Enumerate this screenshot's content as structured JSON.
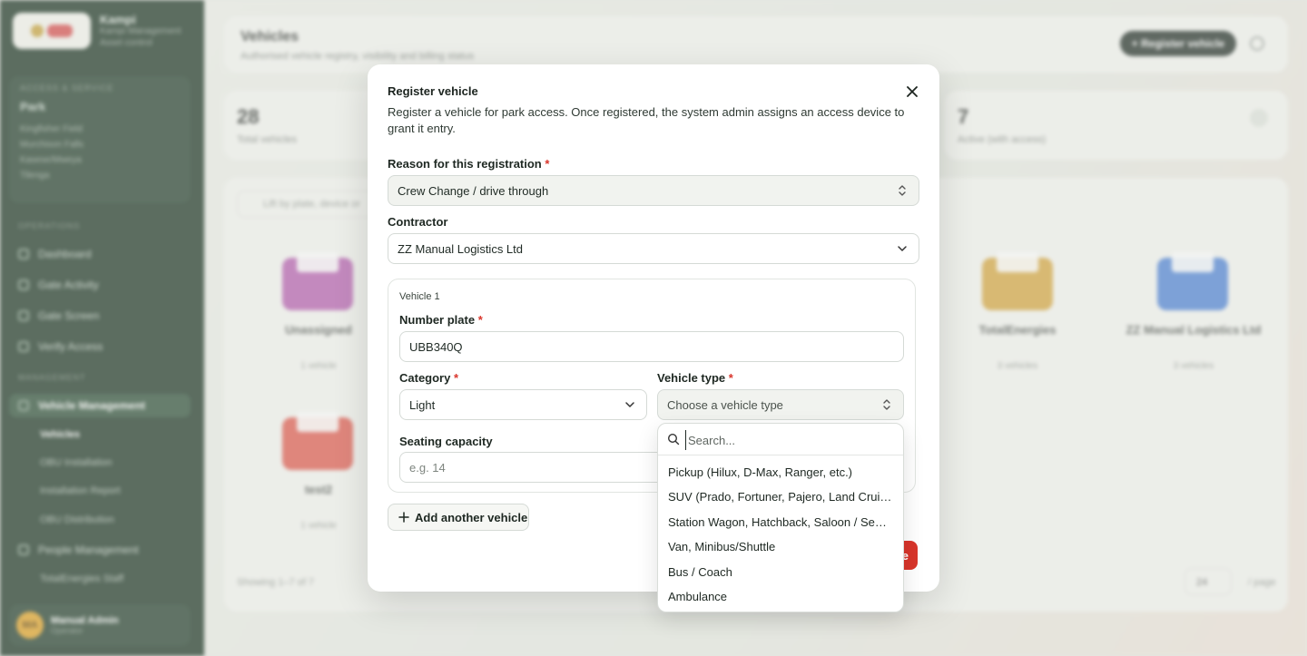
{
  "background": {
    "brand": {
      "name": "Kampi",
      "line1": "Kampi Management",
      "line2": "Asset control"
    },
    "park": {
      "heading": "ACCESS & SERVICE",
      "value": "Park",
      "lines": [
        "Kingfisher Field",
        "Murchison Falls",
        "Kasese/Mweya",
        "Tilenga"
      ]
    },
    "sections": {
      "operations": "OPERATIONS",
      "management": "MANAGEMENT"
    },
    "nav": {
      "dashboard": "Dashboard",
      "gate_activity": "Gate Activity",
      "gate_screen": "Gate Screen",
      "verify_access": "Verify Access",
      "vehicle_management": "Vehicle Management",
      "vehicles": "Vehicles",
      "obu_installation": "OBU Installation",
      "installation_report": "Installation Report",
      "obu_distribution": "OBU Distribution",
      "people_management": "People Management",
      "totalenergies_staff": "TotalEnergies Staff"
    },
    "user": {
      "initials": "MA",
      "name": "Manual Admin",
      "role": "Operator"
    },
    "header": {
      "title": "Vehicles",
      "subtitle": "Authorised vehicle registry, visibility and billing status",
      "register_btn": "+ Register vehicle"
    },
    "stats": [
      {
        "value": "28",
        "label": "Total vehicles"
      },
      {
        "value": "7",
        "label": "Active (with access)"
      }
    ],
    "search_placeholder": "Lift by plate, device or",
    "folders": [
      {
        "name": "Unassigned",
        "count": "1 vehicle",
        "color": "#b65bb0"
      },
      {
        "name": "TotalEnergies",
        "count": "3 vehicles",
        "color": "#d6a53c"
      },
      {
        "name": "ZZ Manual Logistics Ltd",
        "count": "3 vehicles",
        "color": "#4a80d6"
      },
      {
        "name": "test2",
        "count": "1 vehicle",
        "color": "#e0564a"
      }
    ],
    "showing": "Showing 1–7 of 7",
    "page_size": "24",
    "per_page": "/ page"
  },
  "modal": {
    "title": "Register vehicle",
    "description": "Register a vehicle for park access. Once registered, the system admin assigns an access device to grant it entry.",
    "reason": {
      "label": "Reason for this registration",
      "required": "*",
      "value": "Crew Change / drive through"
    },
    "contractor": {
      "label": "Contractor",
      "value": "ZZ Manual Logistics Ltd"
    },
    "vehicle": {
      "tag": "Vehicle 1",
      "plate": {
        "label": "Number plate",
        "required": "*",
        "value": "UBB340Q"
      },
      "category": {
        "label": "Category",
        "required": "*",
        "value": "Light"
      },
      "vehicle_type": {
        "label": "Vehicle type",
        "required": "*",
        "placeholder": "Choose a vehicle type"
      },
      "seating": {
        "label": "Seating capacity",
        "placeholder": "e.g. 14"
      }
    },
    "add_another": "Add another vehicle",
    "submit_label": "e"
  },
  "dropdown": {
    "search_placeholder": "Search...",
    "options": [
      "Pickup (Hilux, D-Max, Ranger, etc.)",
      "SUV (Prado, Fortuner, Pajero, Land Cruiser, etc.)",
      "Station Wagon, Hatchback, Saloon / Sedan",
      "Van, Minibus/Shuttle",
      "Bus / Coach",
      "Ambulance"
    ]
  },
  "colors": {
    "accent": "#d9352b",
    "sidebar": "#17301f",
    "primary_dark": "#1e2a23"
  }
}
